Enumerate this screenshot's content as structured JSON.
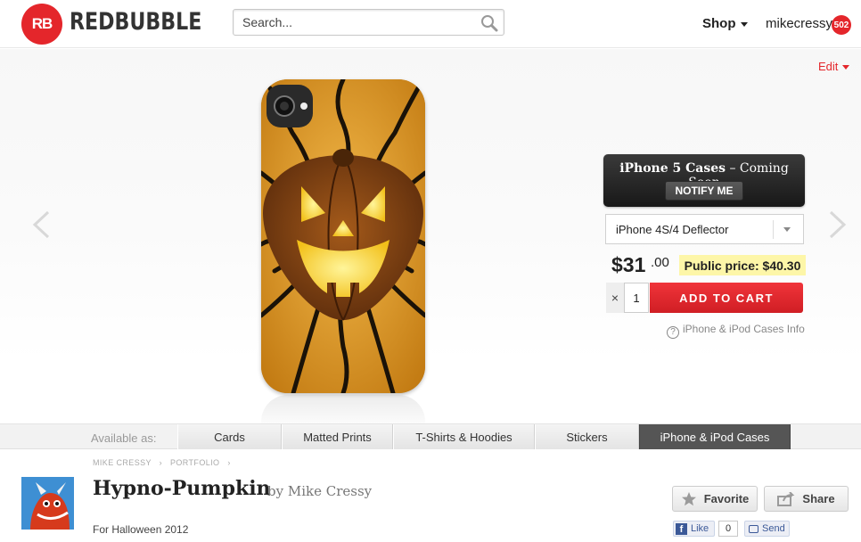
{
  "header": {
    "logo_mark": "RB",
    "logo_text": "REDBUBBLE",
    "search_placeholder": "Search...",
    "shop_label": "Shop",
    "username": "mikecressy",
    "notification_count": "502"
  },
  "stage": {
    "edit_label": "Edit"
  },
  "purchase": {
    "coming_soon_strong": "iPhone 5 Cases",
    "coming_soon_rest": " – Coming Soon",
    "notify_label": "NOTIFY ME",
    "model_selected": "iPhone 4S/4 Deflector",
    "price_main": "$31",
    "price_cents": ".00",
    "public_price": "Public price: $40.30",
    "qty_times": "×",
    "quantity": "1",
    "add_to_cart": "ADD TO CART",
    "info_icon_glyph": "?",
    "info_link": "iPhone & iPod Cases Info"
  },
  "available": {
    "label": "Available as:",
    "tabs": [
      {
        "label": "Cards",
        "active": false
      },
      {
        "label": "Matted Prints",
        "active": false
      },
      {
        "label": "T-Shirts & Hoodies",
        "active": false
      },
      {
        "label": "Stickers",
        "active": false
      },
      {
        "label": "iPhone & iPod Cases",
        "active": true
      }
    ]
  },
  "details": {
    "breadcrumb": [
      "MIKE CRESSY",
      "PORTFOLIO"
    ],
    "breadcrumb_sep": "›",
    "title": "Hypno-Pumpkin",
    "byline": "by Mike Cressy",
    "description": "For Halloween 2012",
    "favorite_label": "Favorite",
    "share_label": "Share",
    "fb_f": "f",
    "fb_like_label": "Like",
    "fb_like_count": "0",
    "fb_send_label": "Send"
  },
  "colors": {
    "brand_red": "#e4262b",
    "public_price_bg": "#fdf6a8",
    "active_tab_bg": "#555555",
    "case_orange": "#c57e14"
  },
  "icons": [
    "logo-mark-icon",
    "search-icon",
    "chevron-down-icon",
    "arrow-left-icon",
    "arrow-right-icon",
    "info-icon",
    "star-icon",
    "share-icon",
    "facebook-icon",
    "send-icon"
  ]
}
